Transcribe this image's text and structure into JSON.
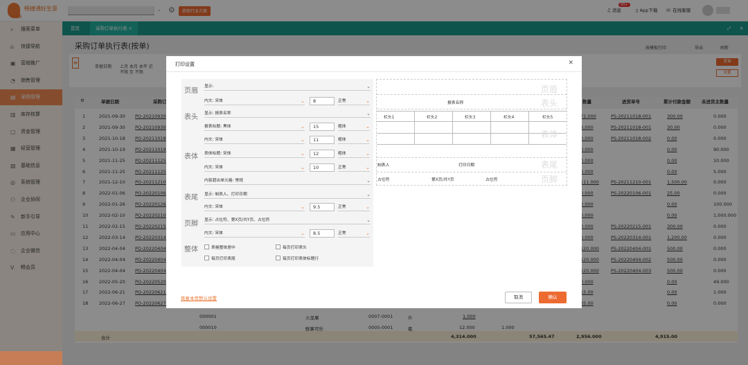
{
  "app": {
    "logo_title": "畅捷通好生意",
    "logo_sub": "畅捷通",
    "industry_btn": "获取行业方案",
    "messages": "消息",
    "messages_badge": "99+",
    "app_download": "App下载",
    "online_service": "在线客服"
  },
  "sidebar": {
    "items": [
      {
        "label": "搜索菜单",
        "icon": "search-icon",
        "glyph": "⌕"
      },
      {
        "label": "快捷导航",
        "icon": "home-icon",
        "glyph": "⌂"
      },
      {
        "label": "营销推广",
        "icon": "shop-icon",
        "glyph": "▣"
      },
      {
        "label": "销售管理",
        "icon": "sales-icon",
        "glyph": "◔"
      },
      {
        "label": "采购管理",
        "icon": "purchase-icon",
        "glyph": "▤",
        "active": true
      },
      {
        "label": "库存核算",
        "icon": "inventory-icon",
        "glyph": "▥"
      },
      {
        "label": "资金管理",
        "icon": "money-icon",
        "glyph": "▢"
      },
      {
        "label": "经营管理",
        "icon": "chart-icon",
        "glyph": "▦"
      },
      {
        "label": "基础信息",
        "icon": "info-icon",
        "glyph": "▧"
      },
      {
        "label": "系统管理",
        "icon": "system-icon",
        "glyph": "◎"
      },
      {
        "label": "企业协同",
        "icon": "team-icon",
        "glyph": "⚇"
      },
      {
        "label": "新手引导",
        "icon": "guide-icon",
        "glyph": "✎"
      },
      {
        "label": "应用中心",
        "icon": "apps-icon",
        "glyph": "▭"
      },
      {
        "label": "企业微信",
        "icon": "wechat-icon",
        "glyph": "◌"
      },
      {
        "label": "畅会员",
        "icon": "vip-icon",
        "glyph": "V"
      }
    ]
  },
  "tabs": [
    {
      "label": "首页"
    },
    {
      "label": "采购订单执行表 ×"
    }
  ],
  "page": {
    "title": "采购订单执行表(按单)",
    "tools": [
      "按模板打印",
      "导出",
      "刷新"
    ],
    "filter_labels": [
      "单据日期",
      "上月 本月 本年 近",
      "不限 至 不限"
    ],
    "query_btn": "查询",
    "settings_btn": "设置"
  },
  "table": {
    "headers": [
      "单据日期",
      "采购订",
      "数量",
      "进货单号",
      "累计付款金额",
      "未进货主数量"
    ],
    "rows": [
      {
        "no": "1",
        "date": "2021-09-30",
        "code": "PO-20210930",
        "qty": "72,000",
        "in_no": "PS-20211018-001",
        "pay": "300.00",
        "rest": "0.000"
      },
      {
        "no": "2",
        "date": "2021-09-30",
        "code": "PO-20210930",
        "qty": "3,000",
        "in_no": "PS-20211018-001",
        "pay": "30.00",
        "rest": "0.000"
      },
      {
        "no": "3",
        "date": "2021-10-18",
        "code": "PO-20211018",
        "qty": "0,000",
        "in_no": "PS-20211018-002",
        "pay": "0.00",
        "rest": "0.000"
      },
      {
        "no": "4",
        "date": "2021-10-19",
        "code": "PO-20211019",
        "qty": "0.000",
        "in_no": "",
        "pay": "0.00",
        "rest": "90.000"
      },
      {
        "no": "5",
        "date": "2021-11-25",
        "code": "PO-20211125",
        "qty": "0.000",
        "in_no": "",
        "pay": "0.00",
        "rest": "10.000"
      },
      {
        "no": "6",
        "date": "2021-11-25",
        "code": "PO-20211125",
        "qty": "0.000",
        "in_no": "",
        "pay": "0.00",
        "rest": "5.000"
      },
      {
        "no": "7",
        "date": "2021-12-10",
        "code": "PO-20211210",
        "qty": "111.000",
        "in_no": "PS-20211210-001",
        "pay": "1,500.00",
        "rest": "0.000"
      },
      {
        "no": "8",
        "date": "2022-01-06",
        "code": "PO-20220106",
        "qty": "0.000",
        "in_no": "PS-20220106-001",
        "pay": "25.00",
        "rest": "0.000"
      },
      {
        "no": "9",
        "date": "2022-01-26",
        "code": "PO-20220126",
        "qty": "0.000",
        "in_no": "",
        "pay": "0.00",
        "rest": "100.000"
      },
      {
        "no": "10",
        "date": "2022-02-10",
        "code": "PO-20220210",
        "qty": "0.000",
        "in_no": "",
        "pay": "0.00",
        "rest": "1,000.000"
      },
      {
        "no": "11",
        "date": "2022-02-15",
        "code": "PO-20220215",
        "qty": "0.000",
        "in_no": "PS-20220215-001",
        "pay": "300.00",
        "rest": "0.000"
      },
      {
        "no": "12",
        "date": "2022-03-14",
        "code": "PO-20220314",
        "qty": "0.000",
        "in_no": "PS-20220314-001",
        "pay": "1,200.00",
        "rest": "0.000"
      },
      {
        "no": "13",
        "date": "2022-04-04",
        "code": "PO-20220404",
        "qty": "120.000",
        "in_no": "PS-20220404-001",
        "pay": "500.00",
        "rest": "0.000"
      },
      {
        "no": "14",
        "date": "2022-04-04",
        "code": "PO-20220404",
        "qty": "120.000",
        "in_no": "PS-20220404-002",
        "pay": "500.00",
        "rest": "0.000"
      },
      {
        "no": "15",
        "date": "2022-04-04",
        "code": "PO-20220404",
        "qty": "120.000",
        "in_no": "PS-20220404-003",
        "pay": "500.00",
        "rest": "0.000"
      },
      {
        "no": "16",
        "date": "2022-05-20",
        "code": "PO-20220520",
        "qty": "0.000",
        "in_no": "",
        "pay": "0.00",
        "rest": "49.000"
      },
      {
        "no": "17",
        "date": "2022-06-21",
        "code": "PO-20220621-015",
        "qty": "15.00",
        "in_no": "",
        "pay": "0.00",
        "rest": "1.000"
      },
      {
        "no": "18",
        "date": "2022-06-27",
        "code": "PO-20220627-016",
        "qty": "35.00",
        "in_no": "",
        "pay": "0.00",
        "rest": "0.000"
      }
    ],
    "row17_extra": [
      "000001",
      "火龙果",
      "0007-0001",
      "斤",
      "1.000"
    ],
    "row18_extra": [
      "000010",
      "鲜果可乐",
      "0005-0001",
      "瓶",
      "12.000",
      "1.000"
    ],
    "total": {
      "label": "合计",
      "v1": "4,314.000",
      "v2": "57,565.47",
      "v3": "2,956.000",
      "v4": "4,915.00"
    }
  },
  "dialog": {
    "title": "打印设置",
    "sections": {
      "header": "页眉",
      "title": "表头",
      "body": "表体",
      "footer_tail": "表尾",
      "footer": "页脚",
      "overall": "整体"
    },
    "header_show": "显示:",
    "header_font": "内文: 宋体",
    "header_size": "8",
    "header_style": "正常",
    "title_show": "显示: 报表名称",
    "title_font": "报表标题: 黑体",
    "title_size": "15",
    "title_style": "粗体",
    "title_text_font": "内文: 宋体",
    "title_text_size": "11",
    "title_text_style": "粗体",
    "body_font": "表体标题: 宋体",
    "body_size": "12",
    "body_style": "粗体",
    "body_text_font": "内文: 宋体",
    "body_text_size": "10",
    "body_text_style": "正常",
    "overflow": "内容超出单元格: 常规",
    "tail_show": "显示: 制表人、打印日期",
    "tail_font": "内文: 宋体",
    "tail_size": "9.5",
    "tail_style": "正常",
    "foot_show": "显示: 占位符、第X页/共Y页、占位符",
    "foot_font": "内文: 宋体",
    "foot_size": "8.5",
    "foot_style": "正常",
    "checks": [
      "表格整体居中",
      "每页打印表头",
      "每页打印表尾",
      "每页打印表体标题行"
    ],
    "preview": {
      "report_name": "报表名称",
      "cols": [
        "栏头1",
        "栏头2",
        "栏头3",
        "栏头4",
        "栏头5"
      ],
      "maker": "制表人",
      "print_date": "打印日期",
      "placeholder1": "占位符",
      "page_info": "第X页/共Y页",
      "placeholder2": "占位符"
    },
    "reset": "恢复本页默认设置",
    "cancel": "取消",
    "confirm": "确认"
  }
}
